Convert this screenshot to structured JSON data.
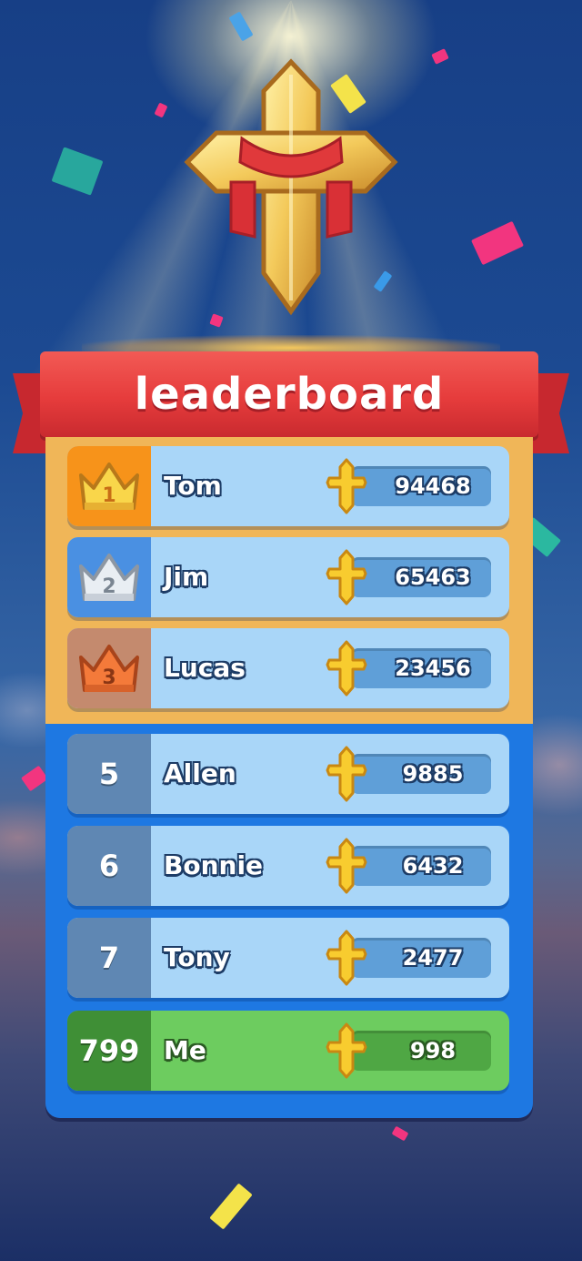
{
  "title": "leaderboard",
  "colors": {
    "banner": "#e63c3c",
    "board_top": "#f0b658",
    "board_bottom": "#1e78e2",
    "row": "#a9d6f8",
    "me_row": "#6dcc5f",
    "gold": "#f7931a",
    "silver": "#4a90e2",
    "bronze": "#c48a6e",
    "plain_rank": "#5f87b3",
    "me_rank": "#3f8f36"
  },
  "icons": {
    "hero": "golden-cross-icon",
    "score": "cross-icon",
    "top_ranks": "crown-icon"
  },
  "top3": [
    {
      "rank": "1",
      "name": "Tom",
      "score": "94468",
      "medal": "gold"
    },
    {
      "rank": "2",
      "name": "Jim",
      "score": "65463",
      "medal": "silver"
    },
    {
      "rank": "3",
      "name": "Lucas",
      "score": "23456",
      "medal": "bronze"
    }
  ],
  "others": [
    {
      "rank": "5",
      "name": "Allen",
      "score": "9885"
    },
    {
      "rank": "6",
      "name": "Bonnie",
      "score": "6432"
    },
    {
      "rank": "7",
      "name": "Tony",
      "score": "2477"
    }
  ],
  "me": {
    "rank": "799",
    "name": "Me",
    "score": "998"
  }
}
